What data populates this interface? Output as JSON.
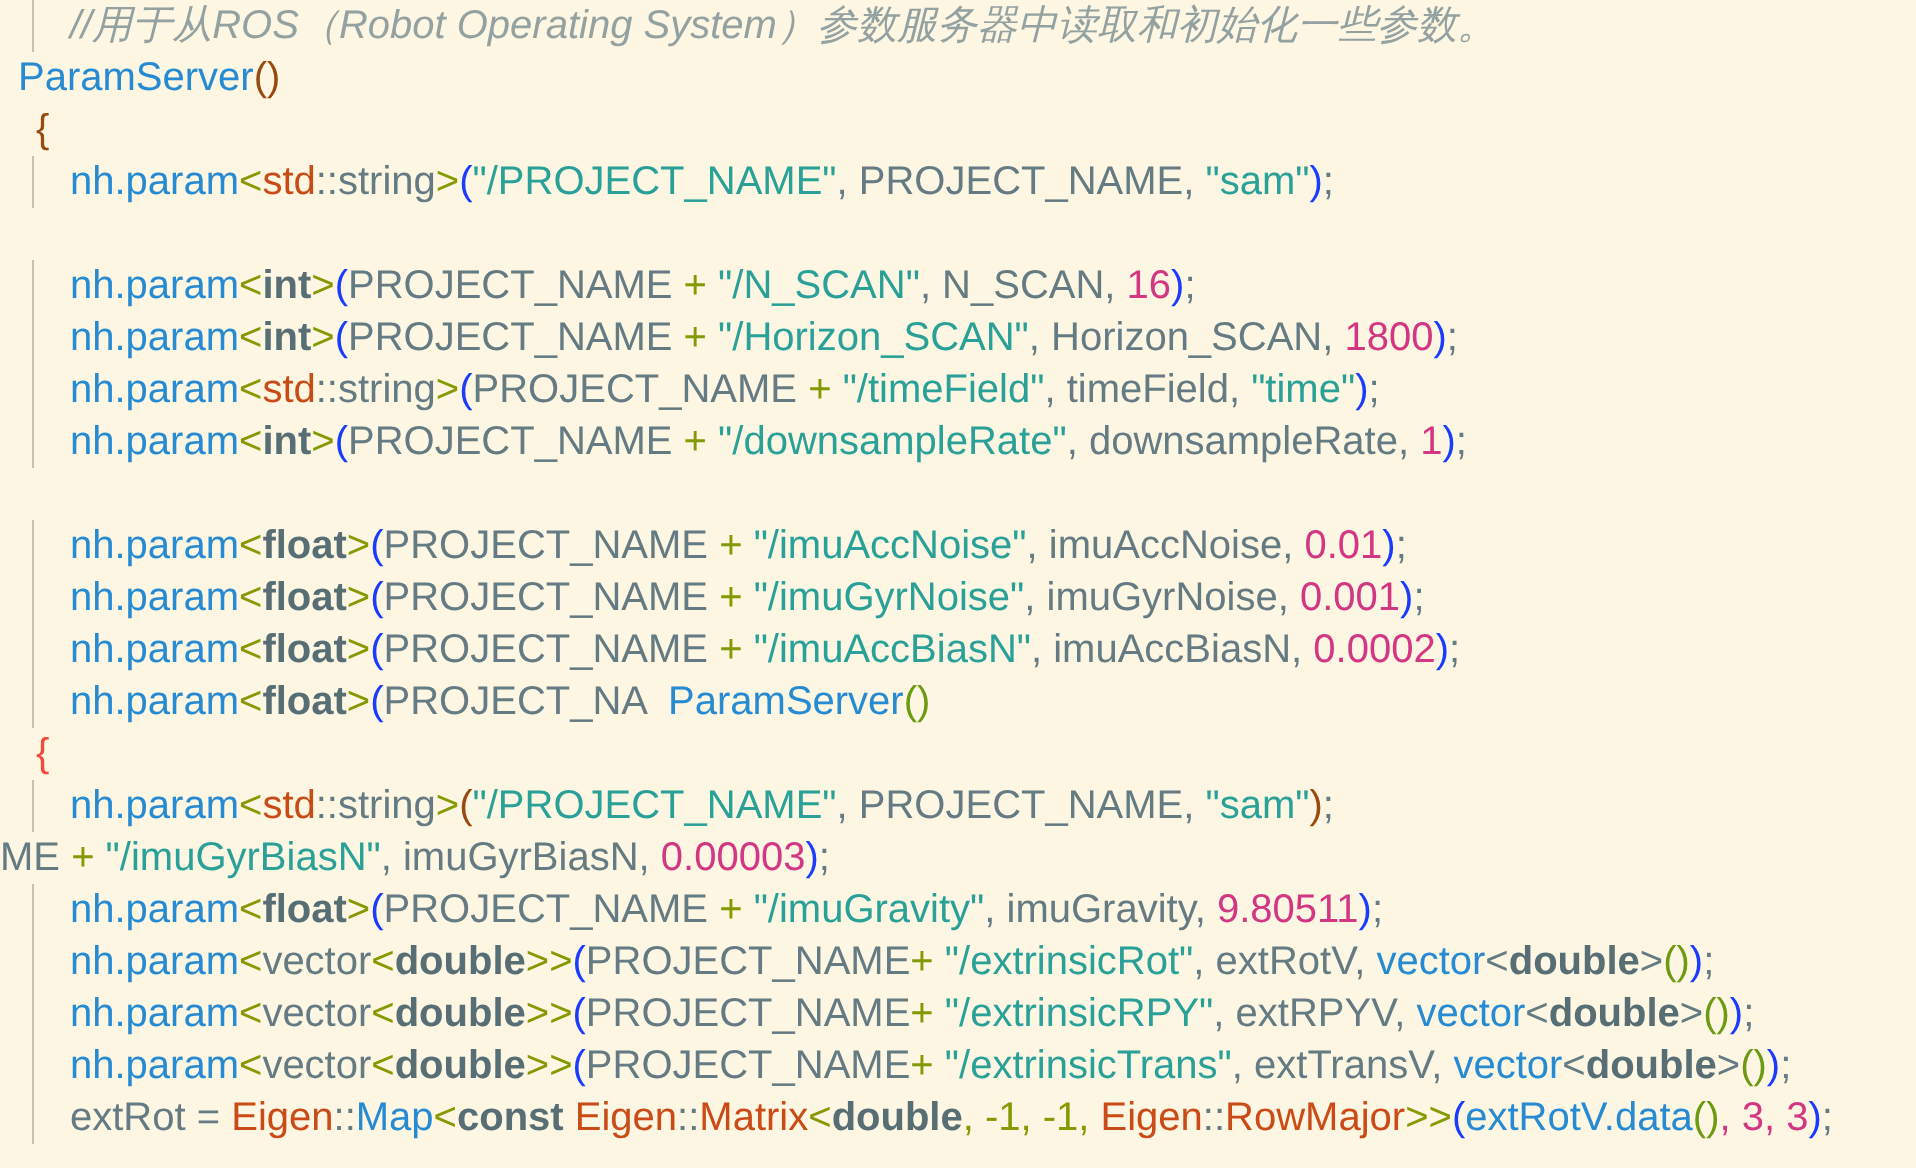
{
  "editor": {
    "lines": [
      {
        "kind": "body",
        "tokens": [
          {
            "text": "//用于从ROS（Robot Operating System）参数服务器中读取和初始化一些参数。",
            "kind": "comment"
          }
        ]
      },
      {
        "kind": "header",
        "tokens": [
          {
            "text": "ParamServer",
            "kind": "func"
          },
          {
            "text": "()",
            "kind": "paren-brown"
          }
        ]
      },
      {
        "kind": "brace",
        "tokens": [
          {
            "text": "{",
            "kind": "paren-brown"
          }
        ]
      },
      {
        "kind": "body",
        "tokens": [
          {
            "text": "nh.param",
            "kind": "func"
          },
          {
            "text": "<",
            "kind": "angle"
          },
          {
            "text": "std",
            "kind": "type"
          },
          {
            "text": "::string",
            "kind": "plain"
          },
          {
            "text": ">",
            "kind": "angle"
          },
          {
            "text": "(",
            "kind": "paren-blue"
          },
          {
            "text": "\"/PROJECT_NAME\"",
            "kind": "string"
          },
          {
            "text": ", PROJECT_NAME, ",
            "kind": "plain"
          },
          {
            "text": "\"sam\"",
            "kind": "string"
          },
          {
            "text": ")",
            "kind": "paren-blue"
          },
          {
            "text": ";",
            "kind": "plain"
          }
        ]
      },
      {
        "kind": "blank"
      },
      {
        "kind": "body",
        "tokens": [
          {
            "text": "nh.param",
            "kind": "func"
          },
          {
            "text": "<",
            "kind": "angle"
          },
          {
            "text": "int",
            "kind": "keyword"
          },
          {
            "text": ">",
            "kind": "angle"
          },
          {
            "text": "(",
            "kind": "paren-blue"
          },
          {
            "text": "PROJECT_NAME ",
            "kind": "plain"
          },
          {
            "text": "+",
            "kind": "angle"
          },
          {
            "text": " \"/N_SCAN\"",
            "kind": "string"
          },
          {
            "text": ", N_SCAN, ",
            "kind": "plain"
          },
          {
            "text": "16",
            "kind": "number"
          },
          {
            "text": ")",
            "kind": "paren-blue"
          },
          {
            "text": ";",
            "kind": "plain"
          }
        ]
      },
      {
        "kind": "body",
        "tokens": [
          {
            "text": "nh.param",
            "kind": "func"
          },
          {
            "text": "<",
            "kind": "angle"
          },
          {
            "text": "int",
            "kind": "keyword"
          },
          {
            "text": ">",
            "kind": "angle"
          },
          {
            "text": "(",
            "kind": "paren-blue"
          },
          {
            "text": "PROJECT_NAME ",
            "kind": "plain"
          },
          {
            "text": "+",
            "kind": "angle"
          },
          {
            "text": " \"/Horizon_SCAN\"",
            "kind": "string"
          },
          {
            "text": ", Horizon_SCAN, ",
            "kind": "plain"
          },
          {
            "text": "1800",
            "kind": "number"
          },
          {
            "text": ")",
            "kind": "paren-blue"
          },
          {
            "text": ";",
            "kind": "plain"
          }
        ]
      },
      {
        "kind": "body",
        "tokens": [
          {
            "text": "nh.param",
            "kind": "func"
          },
          {
            "text": "<",
            "kind": "angle"
          },
          {
            "text": "std",
            "kind": "type"
          },
          {
            "text": "::string",
            "kind": "plain"
          },
          {
            "text": ">",
            "kind": "angle"
          },
          {
            "text": "(",
            "kind": "paren-blue"
          },
          {
            "text": "PROJECT_NAME ",
            "kind": "plain"
          },
          {
            "text": "+",
            "kind": "angle"
          },
          {
            "text": " \"/timeField\"",
            "kind": "string"
          },
          {
            "text": ", timeField, ",
            "kind": "plain"
          },
          {
            "text": "\"time\"",
            "kind": "string"
          },
          {
            "text": ")",
            "kind": "paren-blue"
          },
          {
            "text": ";",
            "kind": "plain"
          }
        ]
      },
      {
        "kind": "body",
        "tokens": [
          {
            "text": "nh.param",
            "kind": "func"
          },
          {
            "text": "<",
            "kind": "angle"
          },
          {
            "text": "int",
            "kind": "keyword"
          },
          {
            "text": ">",
            "kind": "angle"
          },
          {
            "text": "(",
            "kind": "paren-blue"
          },
          {
            "text": "PROJECT_NAME ",
            "kind": "plain"
          },
          {
            "text": "+",
            "kind": "angle"
          },
          {
            "text": " \"/downsampleRate\"",
            "kind": "string"
          },
          {
            "text": ", downsampleRate, ",
            "kind": "plain"
          },
          {
            "text": "1",
            "kind": "number"
          },
          {
            "text": ")",
            "kind": "paren-blue"
          },
          {
            "text": ";",
            "kind": "plain"
          }
        ]
      },
      {
        "kind": "blank"
      },
      {
        "kind": "body",
        "tokens": [
          {
            "text": "nh.param",
            "kind": "func"
          },
          {
            "text": "<",
            "kind": "angle"
          },
          {
            "text": "float",
            "kind": "keyword"
          },
          {
            "text": ">",
            "kind": "angle"
          },
          {
            "text": "(",
            "kind": "paren-blue"
          },
          {
            "text": "PROJECT_NAME ",
            "kind": "plain"
          },
          {
            "text": "+",
            "kind": "angle"
          },
          {
            "text": " \"/imuAccNoise\"",
            "kind": "string"
          },
          {
            "text": ", imuAccNoise, ",
            "kind": "plain"
          },
          {
            "text": "0.01",
            "kind": "number"
          },
          {
            "text": ")",
            "kind": "paren-blue"
          },
          {
            "text": ";",
            "kind": "plain"
          }
        ]
      },
      {
        "kind": "body",
        "tokens": [
          {
            "text": "nh.param",
            "kind": "func"
          },
          {
            "text": "<",
            "kind": "angle"
          },
          {
            "text": "float",
            "kind": "keyword"
          },
          {
            "text": ">",
            "kind": "angle"
          },
          {
            "text": "(",
            "kind": "paren-blue"
          },
          {
            "text": "PROJECT_NAME ",
            "kind": "plain"
          },
          {
            "text": "+",
            "kind": "angle"
          },
          {
            "text": " \"/imuGyrNoise\"",
            "kind": "string"
          },
          {
            "text": ", imuGyrNoise, ",
            "kind": "plain"
          },
          {
            "text": "0.001",
            "kind": "number"
          },
          {
            "text": ")",
            "kind": "paren-blue"
          },
          {
            "text": ";",
            "kind": "plain"
          }
        ]
      },
      {
        "kind": "body",
        "tokens": [
          {
            "text": "nh.param",
            "kind": "func"
          },
          {
            "text": "<",
            "kind": "angle"
          },
          {
            "text": "float",
            "kind": "keyword"
          },
          {
            "text": ">",
            "kind": "angle"
          },
          {
            "text": "(",
            "kind": "paren-blue"
          },
          {
            "text": "PROJECT_NAME ",
            "kind": "plain"
          },
          {
            "text": "+",
            "kind": "angle"
          },
          {
            "text": " \"/imuAccBiasN\"",
            "kind": "string"
          },
          {
            "text": ", imuAccBiasN, ",
            "kind": "plain"
          },
          {
            "text": "0.0002",
            "kind": "number"
          },
          {
            "text": ")",
            "kind": "paren-blue"
          },
          {
            "text": ";",
            "kind": "plain"
          }
        ]
      },
      {
        "kind": "body",
        "tokens": [
          {
            "text": "nh.param",
            "kind": "func"
          },
          {
            "text": "<",
            "kind": "angle"
          },
          {
            "text": "float",
            "kind": "keyword"
          },
          {
            "text": ">",
            "kind": "angle"
          },
          {
            "text": "(",
            "kind": "paren-blue"
          },
          {
            "text": "PROJECT_NA  ",
            "kind": "plain"
          },
          {
            "text": "ParamServer",
            "kind": "func"
          },
          {
            "text": "()",
            "kind": "paren-green"
          }
        ]
      },
      {
        "kind": "brace",
        "tokens": [
          {
            "text": "{",
            "kind": "paren-red"
          }
        ]
      },
      {
        "kind": "body",
        "tokens": [
          {
            "text": "nh.param",
            "kind": "func"
          },
          {
            "text": "<",
            "kind": "angle"
          },
          {
            "text": "std",
            "kind": "type"
          },
          {
            "text": "::string",
            "kind": "plain"
          },
          {
            "text": ">",
            "kind": "angle"
          },
          {
            "text": "(",
            "kind": "paren-brown"
          },
          {
            "text": "\"/PROJECT_NAME\"",
            "kind": "string"
          },
          {
            "text": ", PROJECT_NAME, ",
            "kind": "plain"
          },
          {
            "text": "\"sam\"",
            "kind": "string"
          },
          {
            "text": ")",
            "kind": "paren-brown"
          },
          {
            "text": ";",
            "kind": "plain"
          }
        ]
      },
      {
        "kind": "flush",
        "tokens": [
          {
            "text": "ME ",
            "kind": "plain"
          },
          {
            "text": "+",
            "kind": "angle"
          },
          {
            "text": " \"/imuGyrBiasN\"",
            "kind": "string"
          },
          {
            "text": ", imuGyrBiasN, ",
            "kind": "plain"
          },
          {
            "text": "0.00003",
            "kind": "number"
          },
          {
            "text": ")",
            "kind": "paren-blue"
          },
          {
            "text": ";",
            "kind": "plain"
          }
        ]
      },
      {
        "kind": "body",
        "tokens": [
          {
            "text": "nh.param",
            "kind": "func"
          },
          {
            "text": "<",
            "kind": "angle"
          },
          {
            "text": "float",
            "kind": "keyword"
          },
          {
            "text": ">",
            "kind": "angle"
          },
          {
            "text": "(",
            "kind": "paren-blue"
          },
          {
            "text": "PROJECT_NAME ",
            "kind": "plain"
          },
          {
            "text": "+",
            "kind": "angle"
          },
          {
            "text": " \"/imuGravity\"",
            "kind": "string"
          },
          {
            "text": ", imuGravity, ",
            "kind": "plain"
          },
          {
            "text": "9.80511",
            "kind": "number"
          },
          {
            "text": ")",
            "kind": "paren-blue"
          },
          {
            "text": ";",
            "kind": "plain"
          }
        ]
      },
      {
        "kind": "body",
        "tokens": [
          {
            "text": "nh.param",
            "kind": "func"
          },
          {
            "text": "<",
            "kind": "angle"
          },
          {
            "text": "vector",
            "kind": "plain"
          },
          {
            "text": "<",
            "kind": "angle"
          },
          {
            "text": "double",
            "kind": "keyword"
          },
          {
            "text": ">>",
            "kind": "angle"
          },
          {
            "text": "(",
            "kind": "paren-blue"
          },
          {
            "text": "PROJECT_NAME",
            "kind": "plain"
          },
          {
            "text": "+",
            "kind": "angle"
          },
          {
            "text": " \"/extrinsicRot\"",
            "kind": "string"
          },
          {
            "text": ", extRotV, ",
            "kind": "plain"
          },
          {
            "text": "vector",
            "kind": "func"
          },
          {
            "text": "<",
            "kind": "plain"
          },
          {
            "text": "double",
            "kind": "keyword"
          },
          {
            "text": ">",
            "kind": "plain"
          },
          {
            "text": "()",
            "kind": "paren-green"
          },
          {
            "text": ")",
            "kind": "paren-blue"
          },
          {
            "text": ";",
            "kind": "plain"
          }
        ]
      },
      {
        "kind": "body",
        "tokens": [
          {
            "text": "nh.param",
            "kind": "func"
          },
          {
            "text": "<",
            "kind": "angle"
          },
          {
            "text": "vector",
            "kind": "plain"
          },
          {
            "text": "<",
            "kind": "angle"
          },
          {
            "text": "double",
            "kind": "keyword"
          },
          {
            "text": ">>",
            "kind": "angle"
          },
          {
            "text": "(",
            "kind": "paren-blue"
          },
          {
            "text": "PROJECT_NAME",
            "kind": "plain"
          },
          {
            "text": "+",
            "kind": "angle"
          },
          {
            "text": " \"/extrinsicRPY\"",
            "kind": "string"
          },
          {
            "text": ", extRPYV, ",
            "kind": "plain"
          },
          {
            "text": "vector",
            "kind": "func"
          },
          {
            "text": "<",
            "kind": "plain"
          },
          {
            "text": "double",
            "kind": "keyword"
          },
          {
            "text": ">",
            "kind": "plain"
          },
          {
            "text": "()",
            "kind": "paren-green"
          },
          {
            "text": ")",
            "kind": "paren-blue"
          },
          {
            "text": ";",
            "kind": "plain"
          }
        ]
      },
      {
        "kind": "body",
        "tokens": [
          {
            "text": "nh.param",
            "kind": "func"
          },
          {
            "text": "<",
            "kind": "angle"
          },
          {
            "text": "vector",
            "kind": "plain"
          },
          {
            "text": "<",
            "kind": "angle"
          },
          {
            "text": "double",
            "kind": "keyword"
          },
          {
            "text": ">>",
            "kind": "angle"
          },
          {
            "text": "(",
            "kind": "paren-blue"
          },
          {
            "text": "PROJECT_NAME",
            "kind": "plain"
          },
          {
            "text": "+",
            "kind": "angle"
          },
          {
            "text": " \"/extrinsicTrans\"",
            "kind": "string"
          },
          {
            "text": ", extTransV, ",
            "kind": "plain"
          },
          {
            "text": "vector",
            "kind": "func"
          },
          {
            "text": "<",
            "kind": "plain"
          },
          {
            "text": "double",
            "kind": "keyword"
          },
          {
            "text": ">",
            "kind": "plain"
          },
          {
            "text": "()",
            "kind": "paren-green"
          },
          {
            "text": ")",
            "kind": "paren-blue"
          },
          {
            "text": ";",
            "kind": "plain"
          }
        ]
      },
      {
        "kind": "body",
        "tokens": [
          {
            "text": "extRot = ",
            "kind": "plain"
          },
          {
            "text": "Eigen",
            "kind": "type"
          },
          {
            "text": "::",
            "kind": "plain"
          },
          {
            "text": "Map",
            "kind": "func"
          },
          {
            "text": "<",
            "kind": "angle"
          },
          {
            "text": "const",
            "kind": "keyword"
          },
          {
            "text": " Eigen",
            "kind": "type"
          },
          {
            "text": "::",
            "kind": "plain"
          },
          {
            "text": "Matrix",
            "kind": "type"
          },
          {
            "text": "<",
            "kind": "angle"
          },
          {
            "text": "double",
            "kind": "keyword"
          },
          {
            "text": ", -1, -1, ",
            "kind": "angle"
          },
          {
            "text": "Eigen",
            "kind": "type"
          },
          {
            "text": "::",
            "kind": "plain"
          },
          {
            "text": "RowMajor",
            "kind": "type"
          },
          {
            "text": ">>",
            "kind": "angle"
          },
          {
            "text": "(",
            "kind": "paren-blue"
          },
          {
            "text": "extRotV.data",
            "kind": "func"
          },
          {
            "text": "()",
            "kind": "paren-green"
          },
          {
            "text": ", 3, 3",
            "kind": "number"
          },
          {
            "text": ")",
            "kind": "paren-blue"
          },
          {
            "text": ";",
            "kind": "plain"
          }
        ]
      }
    ]
  }
}
